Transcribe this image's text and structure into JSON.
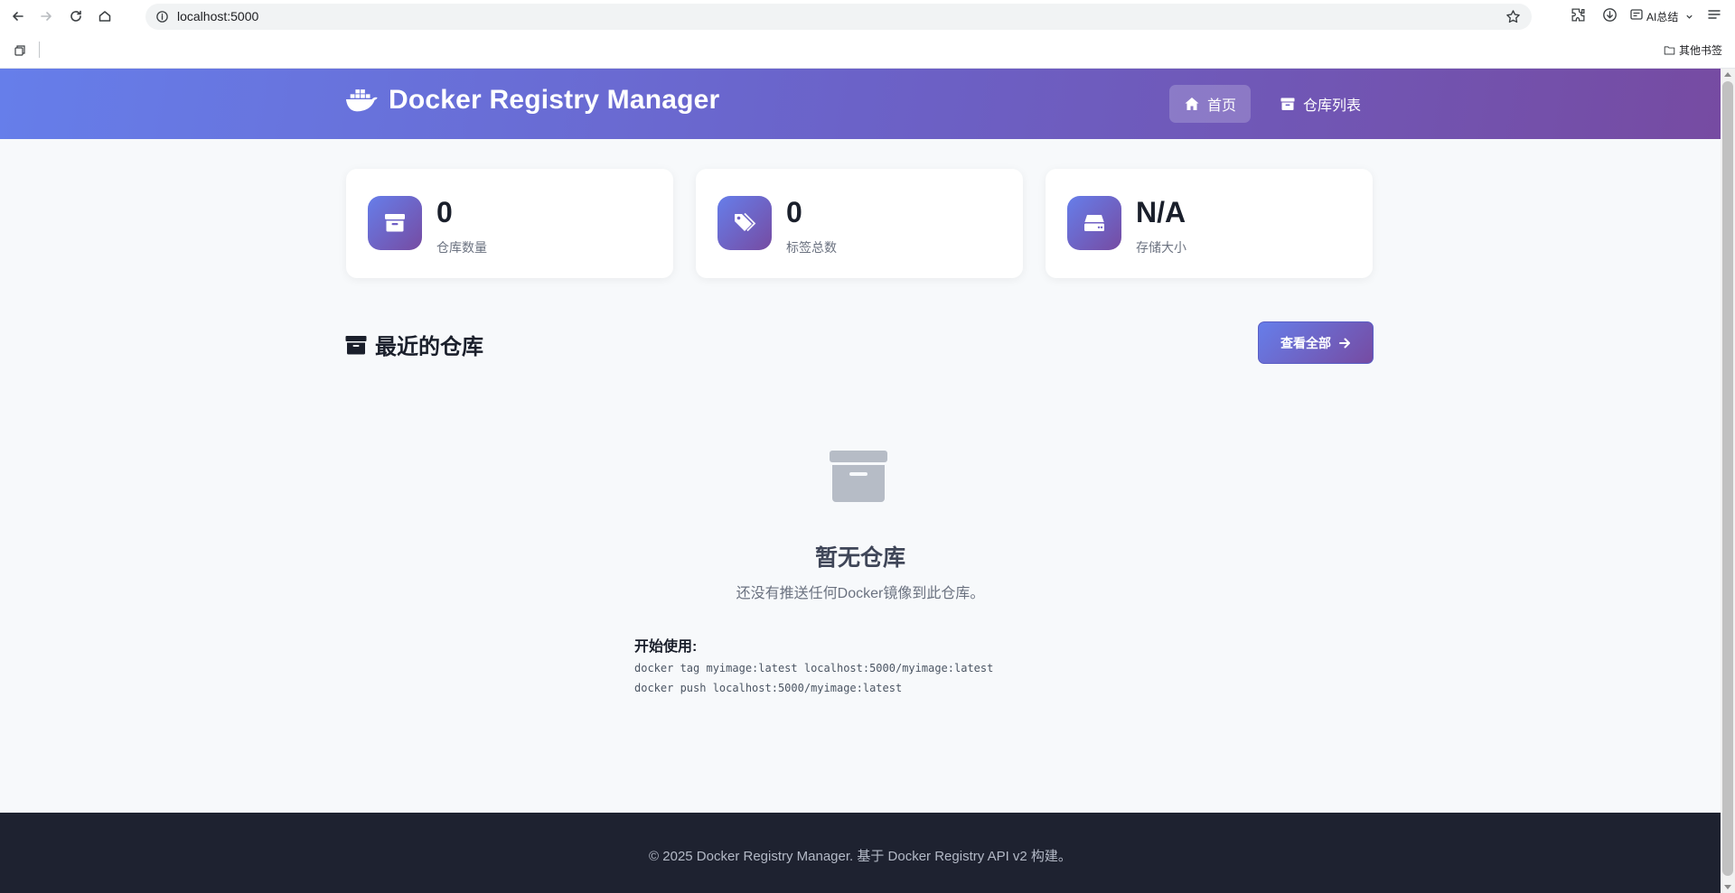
{
  "browser": {
    "url": "localhost:5000",
    "ai_label": "AI总结",
    "bookmarks_other": "其他书签"
  },
  "header": {
    "brand_title": "Docker Registry Manager",
    "nav": [
      {
        "label": "首页",
        "icon": "home-icon",
        "active": true
      },
      {
        "label": "仓库列表",
        "icon": "archive-icon",
        "active": false
      }
    ]
  },
  "stats": [
    {
      "value": "0",
      "label": "仓库数量",
      "icon": "archive-icon"
    },
    {
      "value": "0",
      "label": "标签总数",
      "icon": "tags-icon"
    },
    {
      "value": "N/A",
      "label": "存储大小",
      "icon": "hdd-icon"
    }
  ],
  "recent": {
    "title": "最近的仓库",
    "view_all_label": "查看全部"
  },
  "empty": {
    "title": "暂无仓库",
    "description": "还没有推送任何Docker镜像到此仓库。",
    "getting_started": "开始使用:",
    "commands": [
      "docker tag myimage:latest localhost:5000/myimage:latest",
      "docker push localhost:5000/myimage:latest"
    ]
  },
  "footer": {
    "text": "© 2025 Docker Registry Manager. 基于 Docker Registry API v2 构建。"
  },
  "colors": {
    "gradient_start": "#667eea",
    "gradient_end": "#764ba2",
    "footer_bg": "#1e2230",
    "page_bg": "#f7f9fb"
  }
}
